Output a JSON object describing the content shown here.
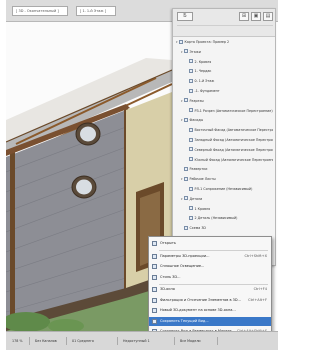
{
  "toolbar": {
    "layer_field": "[ 3D - Окончательный ]",
    "floor_field": "[ 1. 1-й Этаж ]"
  },
  "navigator": {
    "view_selector": "Б",
    "tree": [
      {
        "level": 0,
        "label": "Карта Проекта: Пример 2",
        "toggle": "▾"
      },
      {
        "level": 1,
        "label": "Этажи",
        "toggle": "▾"
      },
      {
        "level": 2,
        "label": "2. Кровля",
        "toggle": ""
      },
      {
        "level": 2,
        "label": "1. Чердак",
        "toggle": ""
      },
      {
        "level": 2,
        "label": "0. 1-й Этаж",
        "toggle": ""
      },
      {
        "level": 2,
        "label": "-1. Фундамент",
        "toggle": ""
      },
      {
        "level": 1,
        "label": "Разрезы",
        "toggle": "▾"
      },
      {
        "level": 2,
        "label": "РЗ-1 Разрез (Автоматическое Перестроение)",
        "toggle": ""
      },
      {
        "level": 1,
        "label": "Фасады",
        "toggle": "▾"
      },
      {
        "level": 2,
        "label": "Восточный Фасад (Автоматическое Перестроение)",
        "toggle": ""
      },
      {
        "level": 2,
        "label": "Западный Фасад (Автоматическое Перестроение)",
        "toggle": ""
      },
      {
        "level": 2,
        "label": "Северный Фасад (Автоматическое Перестроение)",
        "toggle": ""
      },
      {
        "level": 2,
        "label": "Южный Фасад (Автоматическое Перестроение)",
        "toggle": ""
      },
      {
        "level": 1,
        "label": "Развертки",
        "toggle": ""
      },
      {
        "level": 1,
        "label": "Рабочие Листы",
        "toggle": "▾"
      },
      {
        "level": 2,
        "label": "РЛ-1 Сопряжение (Независимый)",
        "toggle": ""
      },
      {
        "level": 1,
        "label": "Детали",
        "toggle": "▾"
      },
      {
        "level": 2,
        "label": "1 Кровля",
        "toggle": ""
      },
      {
        "level": 2,
        "label": "2 Деталь (Независимый)",
        "toggle": ""
      },
      {
        "level": 1,
        "label": "Схема 3D",
        "toggle": ""
      },
      {
        "level": 1,
        "label": "3D-документы",
        "toggle": "▾"
      },
      {
        "level": 2,
        "label": "3D-1 3D-Документ (Автоматическое)",
        "toggle": ""
      }
    ]
  },
  "context_menu": {
    "items": [
      {
        "label": "Открыть",
        "shortcut": "",
        "highlighted": false,
        "sep_after": true
      },
      {
        "label": "Параметры 3D-проекции...",
        "shortcut": "Ctrl+Shift+X",
        "highlighted": false,
        "sep_after": false
      },
      {
        "label": "Сплошное Освещение...",
        "shortcut": "",
        "highlighted": false,
        "sep_after": false
      },
      {
        "label": "Стиль 3D...",
        "shortcut": "",
        "highlighted": false,
        "sep_after": true
      },
      {
        "label": "3D-окно",
        "shortcut": "Ctrl+F4",
        "highlighted": false,
        "sep_after": false
      },
      {
        "label": "Фильтрация и Отсечение Элементов в 3D...",
        "shortcut": "Ctrl+Alt+F",
        "highlighted": false,
        "sep_after": false
      },
      {
        "label": "Новый 3D-документ на основе 3D-окна...",
        "shortcut": "",
        "highlighted": false,
        "sep_after": false
      },
      {
        "label": "Сохранить Текущий Вид...",
        "shortcut": "",
        "highlighted": true,
        "sep_after": false
      },
      {
        "label": "Сохранить Вид и Разместить в Макете",
        "shortcut": "Ctrl+Alt+Shift+S",
        "highlighted": false,
        "sep_after": false
      }
    ]
  },
  "statusbar": {
    "cells": [
      "178 %",
      "Без Каналов",
      "01 Среднего",
      "Недоступный 1",
      "Все Модели"
    ]
  }
}
